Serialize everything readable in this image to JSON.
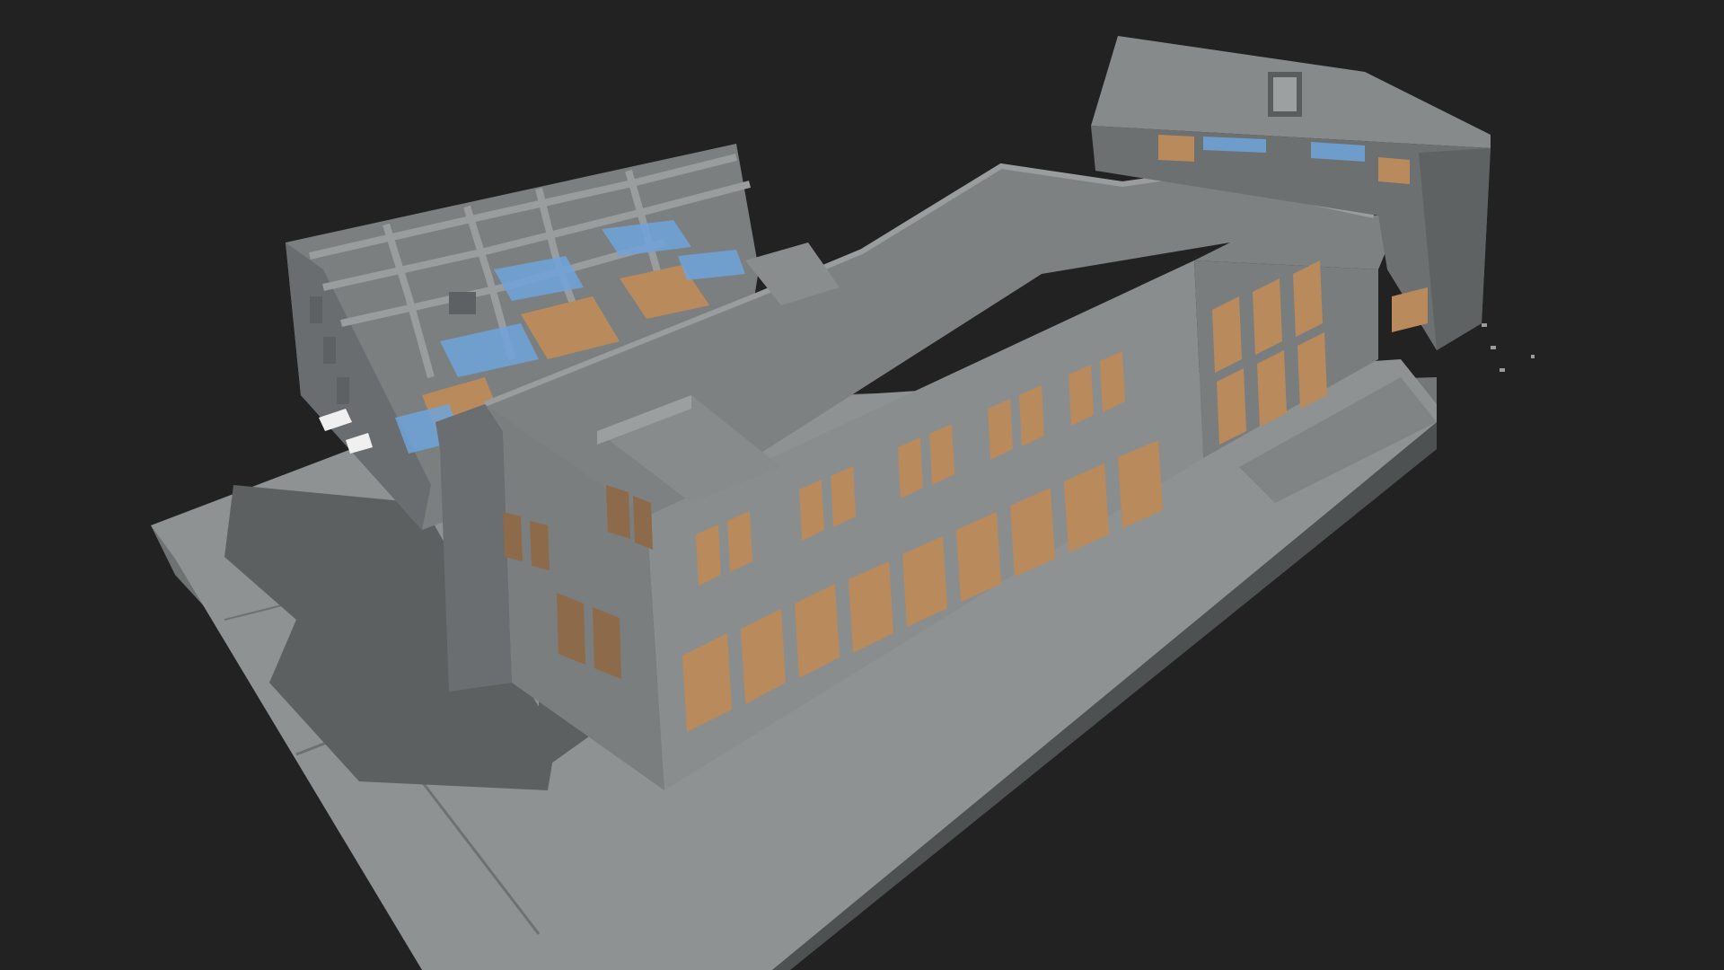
{
  "viewer": {
    "background_color": "#222222",
    "model_colors": {
      "site_slab": "#8e9192",
      "site_slab_edge": "#6a6d6e",
      "shadow": "#5a5d5e",
      "roof": "#7f8283",
      "facade_lit": "#8a8d8e",
      "facade_shade": "#6b6e70",
      "window_glow": "#b98a5c",
      "blue_glass": "#6fa3da"
    },
    "icons": {
      "viewport": "3d-model-icon"
    }
  }
}
